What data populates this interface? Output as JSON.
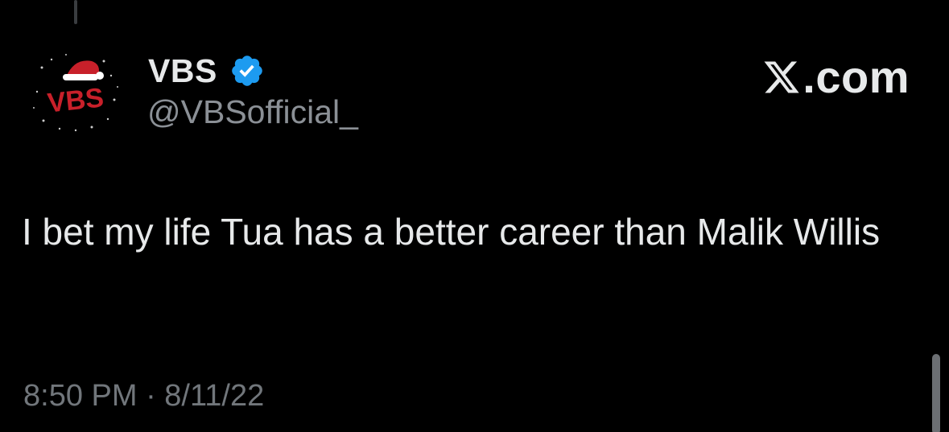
{
  "tweet": {
    "display_name": "VBS",
    "handle": "@VBSofficial_",
    "verified": true,
    "avatar": {
      "icon": "santa-hat-logo",
      "logo_text": "VBS",
      "colors": {
        "logo": "#c8202a",
        "hat_trim": "#ffffff"
      }
    },
    "brand": {
      "icon": "x-logo-icon",
      "text": ".com"
    },
    "body": "I bet my life Tua has a better career than Malik Willis",
    "timestamp": "8:50 PM · 8/11/22"
  },
  "colors": {
    "background": "#000000",
    "text_primary": "#e7e9ea",
    "text_secondary": "#71767b",
    "verified_badge": "#1d9bf0"
  }
}
